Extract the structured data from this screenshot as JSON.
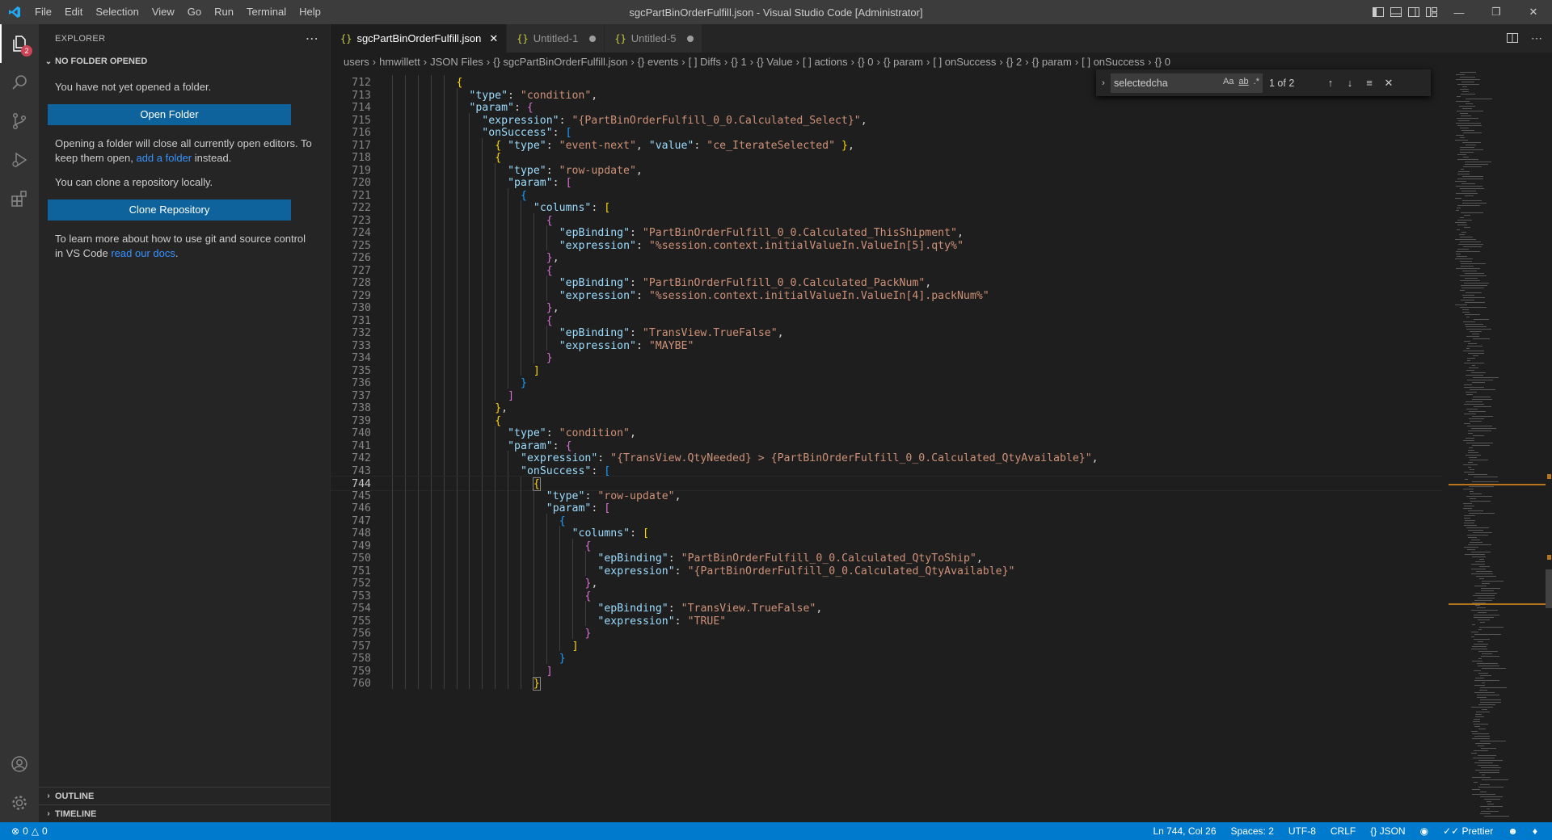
{
  "titlebar": {
    "title": "sgcPartBinOrderFulfill.json - Visual Studio Code [Administrator]",
    "menu": [
      "File",
      "Edit",
      "Selection",
      "View",
      "Go",
      "Run",
      "Terminal",
      "Help"
    ]
  },
  "activity": {
    "explorer_badge": "2"
  },
  "sidebar": {
    "header": "EXPLORER",
    "section": "NO FOLDER OPENED",
    "msg1": "You have not yet opened a folder.",
    "open_folder": "Open Folder",
    "msg2_a": "Opening a folder will close all currently open editors. To keep them open, ",
    "msg2_link": "add a folder",
    "msg2_b": " instead.",
    "msg3": "You can clone a repository locally.",
    "clone": "Clone Repository",
    "msg4_a": "To learn more about how to use git and source control in VS Code ",
    "msg4_link": "read our docs",
    "msg4_b": ".",
    "outline": "OUTLINE",
    "timeline": "TIMELINE"
  },
  "tabs": [
    {
      "label": "sgcPartBinOrderFulfill.json",
      "icon": "{}"
    },
    {
      "label": "Untitled-1",
      "icon": "{}"
    },
    {
      "label": "Untitled-5",
      "icon": "{}"
    }
  ],
  "breadcrumb": [
    "users",
    "hmwillett",
    "JSON Files",
    "{} sgcPartBinOrderFulfill.json",
    "{} events",
    "[ ] Diffs",
    "{} 1",
    "{} Value",
    "[ ] actions",
    "{} 0",
    "{} param",
    "[ ] onSuccess",
    "{} 2",
    "{} param",
    "[ ] onSuccess",
    "{} 0"
  ],
  "find": {
    "query": "selectedcha",
    "opt_case": "Aa",
    "opt_word": "ab",
    "opt_regex": ".*",
    "count": "1 of 2"
  },
  "code": {
    "current_line": "744",
    "lines": [
      {
        "n": "712",
        "i": 5,
        "t": [
          [
            "b1",
            "{"
          ]
        ]
      },
      {
        "n": "713",
        "i": 6,
        "t": [
          [
            "k",
            "\"type\""
          ],
          [
            "p",
            ": "
          ],
          [
            "s",
            "\"condition\""
          ],
          [
            "p",
            ","
          ]
        ]
      },
      {
        "n": "714",
        "i": 6,
        "t": [
          [
            "k",
            "\"param\""
          ],
          [
            "p",
            ": "
          ],
          [
            "b2",
            "{"
          ]
        ]
      },
      {
        "n": "715",
        "i": 7,
        "t": [
          [
            "k",
            "\"expression\""
          ],
          [
            "p",
            ": "
          ],
          [
            "s",
            "\"{PartBinOrderFulfill_0_0.Calculated_Select}\""
          ],
          [
            "p",
            ","
          ]
        ]
      },
      {
        "n": "716",
        "i": 7,
        "t": [
          [
            "k",
            "\"onSuccess\""
          ],
          [
            "p",
            ": "
          ],
          [
            "b3",
            "["
          ]
        ]
      },
      {
        "n": "717",
        "i": 8,
        "t": [
          [
            "b1",
            "{"
          ],
          [
            "p",
            " "
          ],
          [
            "k",
            "\"type\""
          ],
          [
            "p",
            ": "
          ],
          [
            "s",
            "\"event-next\""
          ],
          [
            "p",
            ", "
          ],
          [
            "k",
            "\"value\""
          ],
          [
            "p",
            ": "
          ],
          [
            "s",
            "\"ce_IterateSelected\""
          ],
          [
            "p",
            " "
          ],
          [
            "b1",
            "}"
          ],
          [
            "p",
            ","
          ]
        ]
      },
      {
        "n": "718",
        "i": 8,
        "t": [
          [
            "b1",
            "{"
          ]
        ]
      },
      {
        "n": "719",
        "i": 9,
        "t": [
          [
            "k",
            "\"type\""
          ],
          [
            "p",
            ": "
          ],
          [
            "s",
            "\"row-update\""
          ],
          [
            "p",
            ","
          ]
        ]
      },
      {
        "n": "720",
        "i": 9,
        "t": [
          [
            "k",
            "\"param\""
          ],
          [
            "p",
            ": "
          ],
          [
            "b2",
            "["
          ]
        ]
      },
      {
        "n": "721",
        "i": 10,
        "t": [
          [
            "b3",
            "{"
          ]
        ]
      },
      {
        "n": "722",
        "i": 11,
        "t": [
          [
            "k",
            "\"columns\""
          ],
          [
            "p",
            ": "
          ],
          [
            "b1",
            "["
          ]
        ]
      },
      {
        "n": "723",
        "i": 12,
        "t": [
          [
            "b2",
            "{"
          ]
        ]
      },
      {
        "n": "724",
        "i": 13,
        "t": [
          [
            "k",
            "\"epBinding\""
          ],
          [
            "p",
            ": "
          ],
          [
            "s",
            "\"PartBinOrderFulfill_0_0.Calculated_ThisShipment\""
          ],
          [
            "p",
            ","
          ]
        ]
      },
      {
        "n": "725",
        "i": 13,
        "t": [
          [
            "k",
            "\"expression\""
          ],
          [
            "p",
            ": "
          ],
          [
            "s",
            "\"%session.context.initialValueIn.ValueIn[5].qty%\""
          ]
        ]
      },
      {
        "n": "726",
        "i": 12,
        "t": [
          [
            "b2",
            "}"
          ],
          [
            "p",
            ","
          ]
        ]
      },
      {
        "n": "727",
        "i": 12,
        "t": [
          [
            "b2",
            "{"
          ]
        ]
      },
      {
        "n": "728",
        "i": 13,
        "t": [
          [
            "k",
            "\"epBinding\""
          ],
          [
            "p",
            ": "
          ],
          [
            "s",
            "\"PartBinOrderFulfill_0_0.Calculated_PackNum\""
          ],
          [
            "p",
            ","
          ]
        ]
      },
      {
        "n": "729",
        "i": 13,
        "t": [
          [
            "k",
            "\"expression\""
          ],
          [
            "p",
            ": "
          ],
          [
            "s",
            "\"%session.context.initialValueIn.ValueIn[4].packNum%\""
          ]
        ]
      },
      {
        "n": "730",
        "i": 12,
        "t": [
          [
            "b2",
            "}"
          ],
          [
            "p",
            ","
          ]
        ]
      },
      {
        "n": "731",
        "i": 12,
        "t": [
          [
            "b2",
            "{"
          ]
        ]
      },
      {
        "n": "732",
        "i": 13,
        "t": [
          [
            "k",
            "\"epBinding\""
          ],
          [
            "p",
            ": "
          ],
          [
            "s",
            "\"TransView.TrueFalse\""
          ],
          [
            "p",
            ","
          ]
        ]
      },
      {
        "n": "733",
        "i": 13,
        "t": [
          [
            "k",
            "\"expression\""
          ],
          [
            "p",
            ": "
          ],
          [
            "s",
            "\"MAYBE\""
          ]
        ]
      },
      {
        "n": "734",
        "i": 12,
        "t": [
          [
            "b2",
            "}"
          ]
        ]
      },
      {
        "n": "735",
        "i": 11,
        "t": [
          [
            "b1",
            "]"
          ]
        ]
      },
      {
        "n": "736",
        "i": 10,
        "t": [
          [
            "b3",
            "}"
          ]
        ]
      },
      {
        "n": "737",
        "i": 9,
        "t": [
          [
            "b2",
            "]"
          ]
        ]
      },
      {
        "n": "738",
        "i": 8,
        "t": [
          [
            "b1",
            "}"
          ],
          [
            "p",
            ","
          ]
        ]
      },
      {
        "n": "739",
        "i": 8,
        "t": [
          [
            "b1",
            "{"
          ]
        ]
      },
      {
        "n": "740",
        "i": 9,
        "t": [
          [
            "k",
            "\"type\""
          ],
          [
            "p",
            ": "
          ],
          [
            "s",
            "\"condition\""
          ],
          [
            "p",
            ","
          ]
        ]
      },
      {
        "n": "741",
        "i": 9,
        "t": [
          [
            "k",
            "\"param\""
          ],
          [
            "p",
            ": "
          ],
          [
            "b2",
            "{"
          ]
        ]
      },
      {
        "n": "742",
        "i": 10,
        "t": [
          [
            "k",
            "\"expression\""
          ],
          [
            "p",
            ": "
          ],
          [
            "s",
            "\"{TransView.QtyNeeded} > {PartBinOrderFulfill_0_0.Calculated_QtyAvailable}\""
          ],
          [
            "p",
            ","
          ]
        ]
      },
      {
        "n": "743",
        "i": 10,
        "t": [
          [
            "k",
            "\"onSuccess\""
          ],
          [
            "p",
            ": "
          ],
          [
            "b3",
            "["
          ]
        ]
      },
      {
        "n": "744",
        "i": 11,
        "t": [
          [
            "b1 bm",
            "{"
          ]
        ]
      },
      {
        "n": "745",
        "i": 12,
        "t": [
          [
            "k",
            "\"type\""
          ],
          [
            "p",
            ": "
          ],
          [
            "s",
            "\"row-update\""
          ],
          [
            "p",
            ","
          ]
        ]
      },
      {
        "n": "746",
        "i": 12,
        "t": [
          [
            "k",
            "\"param\""
          ],
          [
            "p",
            ": "
          ],
          [
            "b2",
            "["
          ]
        ]
      },
      {
        "n": "747",
        "i": 13,
        "t": [
          [
            "b3",
            "{"
          ]
        ]
      },
      {
        "n": "748",
        "i": 14,
        "t": [
          [
            "k",
            "\"columns\""
          ],
          [
            "p",
            ": "
          ],
          [
            "b1",
            "["
          ]
        ]
      },
      {
        "n": "749",
        "i": 15,
        "t": [
          [
            "b2",
            "{"
          ]
        ]
      },
      {
        "n": "750",
        "i": 16,
        "t": [
          [
            "k",
            "\"epBinding\""
          ],
          [
            "p",
            ": "
          ],
          [
            "s",
            "\"PartBinOrderFulfill_0_0.Calculated_QtyToShip\""
          ],
          [
            "p",
            ","
          ]
        ]
      },
      {
        "n": "751",
        "i": 16,
        "t": [
          [
            "k",
            "\"expression\""
          ],
          [
            "p",
            ": "
          ],
          [
            "s",
            "\"{PartBinOrderFulfill_0_0.Calculated_QtyAvailable}\""
          ]
        ]
      },
      {
        "n": "752",
        "i": 15,
        "t": [
          [
            "b2",
            "}"
          ],
          [
            "p",
            ","
          ]
        ]
      },
      {
        "n": "753",
        "i": 15,
        "t": [
          [
            "b2",
            "{"
          ]
        ]
      },
      {
        "n": "754",
        "i": 16,
        "t": [
          [
            "k",
            "\"epBinding\""
          ],
          [
            "p",
            ": "
          ],
          [
            "s",
            "\"TransView.TrueFalse\""
          ],
          [
            "p",
            ","
          ]
        ]
      },
      {
        "n": "755",
        "i": 16,
        "t": [
          [
            "k",
            "\"expression\""
          ],
          [
            "p",
            ": "
          ],
          [
            "s",
            "\"TRUE\""
          ]
        ]
      },
      {
        "n": "756",
        "i": 15,
        "t": [
          [
            "b2",
            "}"
          ]
        ]
      },
      {
        "n": "757",
        "i": 14,
        "t": [
          [
            "b1",
            "]"
          ]
        ]
      },
      {
        "n": "758",
        "i": 13,
        "t": [
          [
            "b3",
            "}"
          ]
        ]
      },
      {
        "n": "759",
        "i": 12,
        "t": [
          [
            "b2",
            "]"
          ]
        ]
      },
      {
        "n": "760",
        "i": 11,
        "t": [
          [
            "b1 bm",
            "}"
          ]
        ]
      }
    ]
  },
  "status": {
    "errors": "0",
    "warnings": "0",
    "position": "Ln 744, Col 26",
    "spaces": "Spaces: 2",
    "encoding": "UTF-8",
    "eol": "CRLF",
    "language": "JSON",
    "prettier": "Prettier"
  }
}
